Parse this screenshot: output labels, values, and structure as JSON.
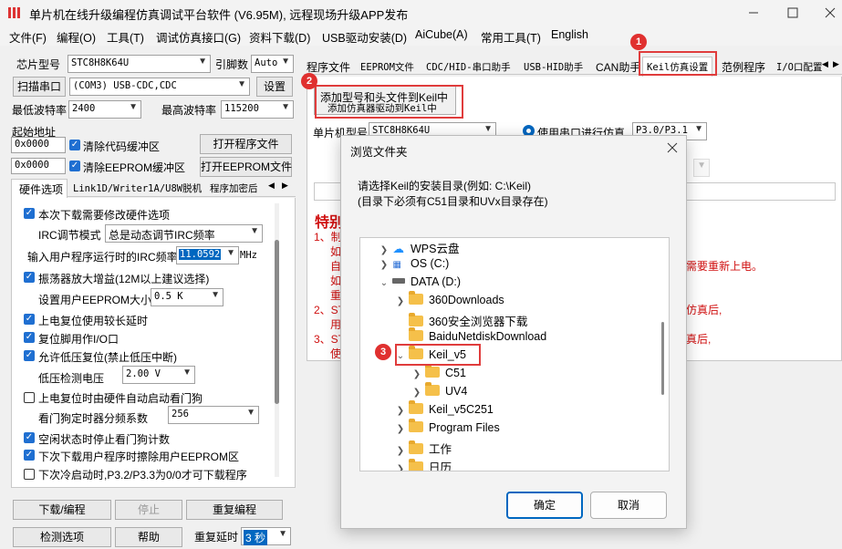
{
  "window": {
    "title": "单片机在线升级编程仿真调试平台软件 (V6.95M), 远程现场升级APP发布"
  },
  "menu": [
    "文件(F)",
    "编程(O)",
    "工具(T)",
    "调试仿真接口(G)",
    "资料下载(D)",
    "USB驱动安装(D)",
    "AiCube(A)",
    "常用工具(T)",
    "English"
  ],
  "left": {
    "chip_label": "芯片型号",
    "chip_value": "STC8H8K64U",
    "pin_label": "引脚数",
    "pin_value": "Auto",
    "scan_button": "扫描串口",
    "port_value": "(COM3) USB-CDC,CDC",
    "settings_button": "设置",
    "min_baud_label": "最低波特率",
    "min_baud_value": "2400",
    "max_baud_label": "最高波特率",
    "max_baud_value": "115200",
    "start_addr_label": "起始地址",
    "addr1": "0x0000",
    "clear_code": "清除代码缓冲区",
    "open_program": "打开程序文件",
    "addr2": "0x0000",
    "clear_eeprom": "清除EEPROM缓冲区",
    "open_eeprom": "打开EEPROM文件",
    "tabs": [
      "硬件选项",
      "Link1D/Writer1A/U8W脱机",
      "程序加密后"
    ],
    "options": [
      {
        "checked": true,
        "text": "本次下载需要修改硬件选项"
      },
      {
        "label": "IRC调节模式",
        "value": "总是动态调节IRC频率"
      },
      {
        "label": "输入用户程序运行时的IRC频率",
        "value": "11.0592",
        "unit": "MHz"
      },
      {
        "checked": true,
        "text": "振荡器放大增益(12M以上建议选择)"
      },
      {
        "label": "设置用户EEPROM大小",
        "value": "0.5 K"
      },
      {
        "checked": true,
        "text": "上电复位使用较长延时"
      },
      {
        "checked": true,
        "text": "复位脚用作I/O口"
      },
      {
        "checked": true,
        "text": "允许低压复位(禁止低压中断)"
      },
      {
        "label": "低压检测电压",
        "value": "2.00 V"
      },
      {
        "checked": false,
        "text": "上电复位时由硬件自动启动看门狗"
      },
      {
        "label": "看门狗定时器分频系数",
        "value": "256"
      },
      {
        "checked": true,
        "text": "空闲状态时停止看门狗计数"
      },
      {
        "checked": true,
        "text": "下次下载用户程序时擦除用户EEPROM区"
      },
      {
        "checked": false,
        "text": "下次冷启动时,P3.2/P3.3为0/0才可下载程序"
      }
    ],
    "download_button": "下载/编程",
    "stop_button": "停止",
    "reprogram_button": "重复编程",
    "detect_button": "检测选项",
    "help_button": "帮助",
    "repeat_delay_label": "重复延时",
    "repeat_delay_value": "3 秒"
  },
  "right": {
    "tabs": [
      "程序文件",
      "EEPROM文件",
      "CDC/HID-串口助手",
      "USB-HID助手",
      "CAN助手",
      "Keil仿真设置",
      "范例程序",
      "I/O口配置"
    ],
    "keil_button_line1": "添加型号和头文件到Keil中",
    "keil_button_line2": "添加仿真器驱动到Keil中",
    "mcu_label": "单片机型号",
    "mcu_value": "STC8H8K64U",
    "serial_sim": "使用串口进行仿真",
    "serial_port": "P3.0/P3.1",
    "special_title": "特别",
    "notes_left": [
      "1、制",
      "如",
      "自",
      "如",
      "重",
      "2、ST",
      "用",
      "3、ST",
      "使"
    ],
    "notes_right": [
      "需要重新上电。",
      "仿真后,",
      "真后,"
    ]
  },
  "badges": [
    "1",
    "2",
    "3"
  ],
  "dialog": {
    "title": "浏览文件夹",
    "desc1": "请选择Keil的安装目录(例如: C:\\Keil)",
    "desc2": "(目录下必须有C51目录和UVx目录存在)",
    "tree": [
      {
        "label": "WPS云盘",
        "icon": "cloud-icon",
        "level": 1,
        "chevron": "right"
      },
      {
        "label": "OS (C:)",
        "icon": "windows-drive-icon",
        "level": 1,
        "chevron": "right"
      },
      {
        "label": "DATA (D:)",
        "icon": "drive-icon",
        "level": 1,
        "chevron": "down"
      },
      {
        "label": "360Downloads",
        "icon": "folder-icon",
        "level": 2,
        "chevron": "right"
      },
      {
        "label": "360安全浏览器下载",
        "icon": "folder-icon",
        "level": 2,
        "chevron": ""
      },
      {
        "label": "BaiduNetdiskDownload",
        "icon": "folder-icon",
        "level": 2,
        "chevron": ""
      },
      {
        "label": "Keil_v5",
        "icon": "folder-icon",
        "level": 2,
        "chevron": "down"
      },
      {
        "label": "C51",
        "icon": "folder-icon",
        "level": 3,
        "chevron": "right"
      },
      {
        "label": "UV4",
        "icon": "folder-icon",
        "level": 3,
        "chevron": "right"
      },
      {
        "label": "Keil_v5C251",
        "icon": "folder-icon",
        "level": 2,
        "chevron": "right"
      },
      {
        "label": "Program Files",
        "icon": "folder-icon",
        "level": 2,
        "chevron": "right"
      },
      {
        "label": "工作",
        "icon": "folder-icon",
        "level": 2,
        "chevron": "right"
      },
      {
        "label": "日历",
        "icon": "folder-icon",
        "level": 2,
        "chevron": "right"
      }
    ],
    "ok_button": "确定",
    "cancel_button": "取消"
  },
  "colors": {
    "highlight_red": "#e03c3c",
    "accent_blue": "#0067c0",
    "checkbox_blue": "#1f6fd1"
  }
}
